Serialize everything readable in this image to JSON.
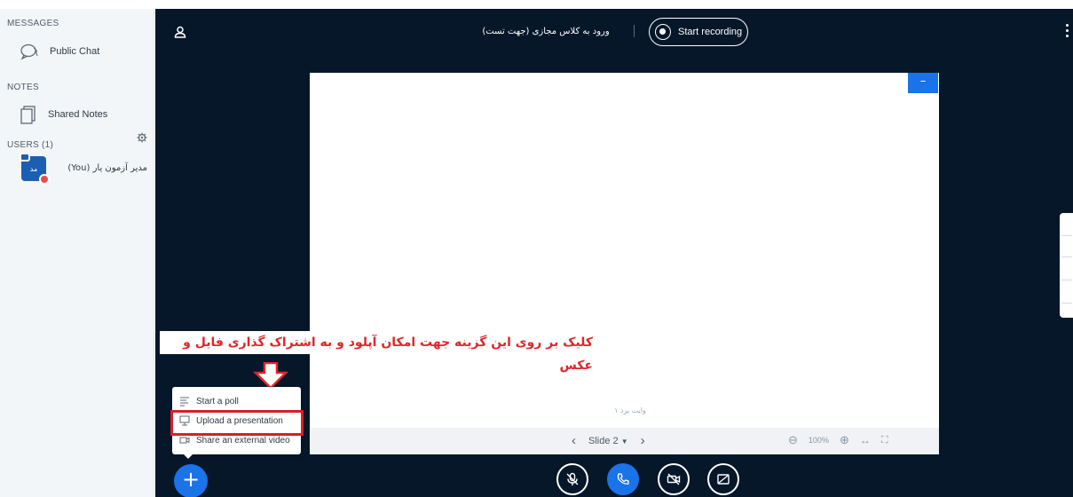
{
  "sidebar": {
    "messages_title": "MESSAGES",
    "public_chat": "Public Chat",
    "notes_title": "NOTES",
    "shared_notes": "Shared Notes",
    "users_title": "USERS (1)",
    "user": {
      "name": "مدیر آزمون یار (You)",
      "avatar_initials": "مد"
    }
  },
  "header": {
    "meeting_title": "ورود به کلاس مجازی (جهت تست)",
    "record_label": "Start recording"
  },
  "presentation": {
    "caption": "وایت برد ۱",
    "slide_label": "Slide 2",
    "zoom": "100%"
  },
  "annotation": {
    "instruction": "کلیک بر روی این گزینه جهت امکان آپلود و به اشتراک گذاری فایل و عکس"
  },
  "actions_menu": {
    "items": [
      {
        "label": "Start a poll",
        "icon": "poll-icon"
      },
      {
        "label": "Upload a presentation",
        "icon": "presentation-icon"
      },
      {
        "label": "Share an external video",
        "icon": "video-icon"
      }
    ]
  },
  "colors": {
    "dark_bg": "#06172a",
    "accent": "#1a73e8",
    "annotation_red": "#e0252b",
    "sidebar_bg": "#f3f6f9"
  }
}
